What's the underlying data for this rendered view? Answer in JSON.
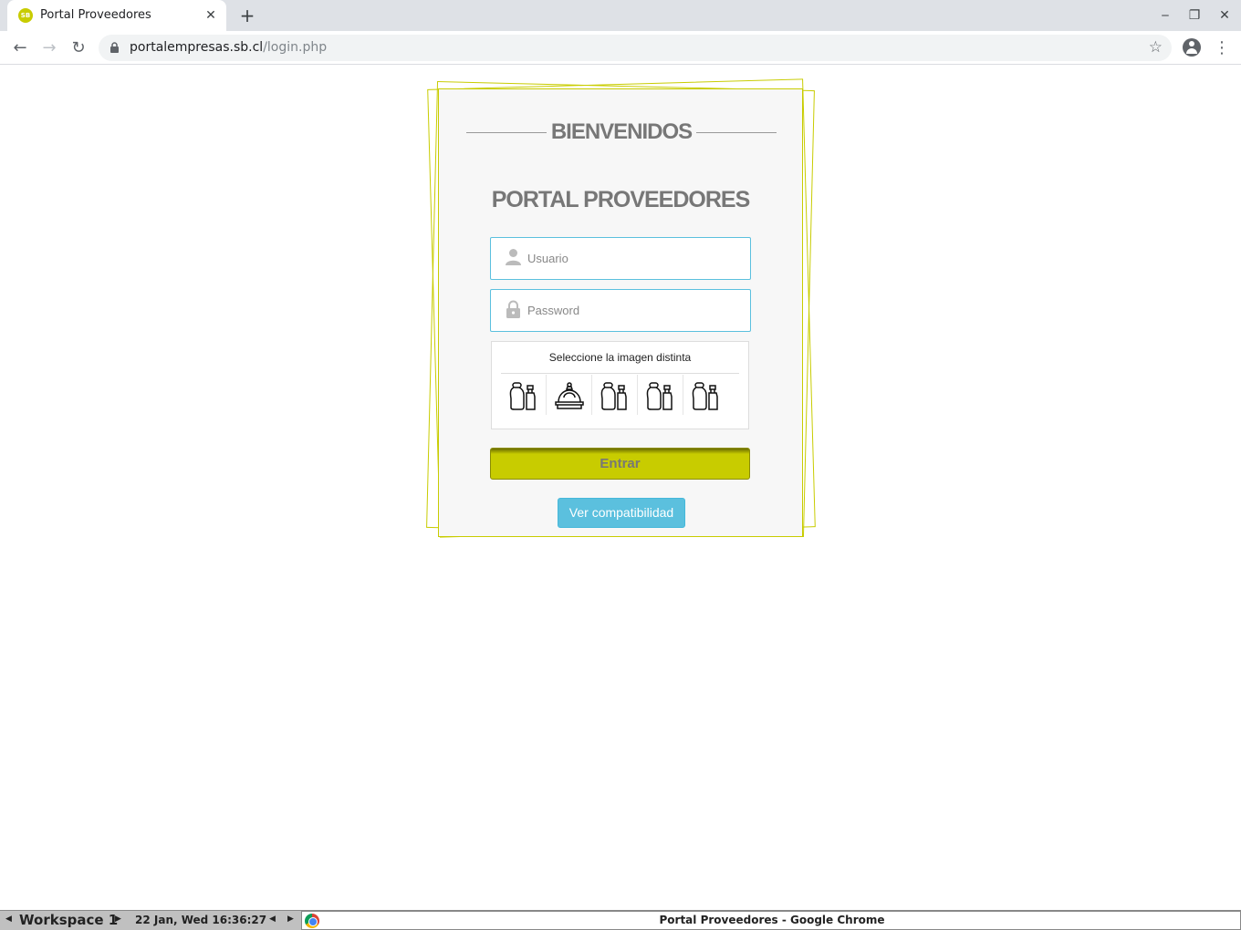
{
  "browser": {
    "tab": {
      "title": "Portal Proveedores",
      "favicon_text": "SB",
      "close_glyph": "✕"
    },
    "new_tab_glyph": "+",
    "window_controls": {
      "minimize": "‒",
      "restore": "❐",
      "close": "✕"
    },
    "nav": {
      "back": "←",
      "forward": "→",
      "reload": "↻"
    },
    "url": {
      "host": "portalempresas.sb.cl",
      "path": "/login.php"
    },
    "star_glyph": "☆",
    "menu_glyph": "⋮"
  },
  "login": {
    "welcome": "BIENVENIDOS",
    "title": "PORTAL PROVEEDORES",
    "username_placeholder": "Usuario",
    "password_placeholder": "Password",
    "captcha_prompt": "Seleccione la imagen distinta",
    "captcha_options": [
      "bottles-icon",
      "crown-pot-icon",
      "bottles-icon",
      "bottles-icon",
      "bottles-icon"
    ],
    "submit_label": "Entrar",
    "compat_label": "Ver compatibilidad"
  },
  "colors": {
    "accent": "#c8cc00",
    "info": "#5bc0de",
    "title_gray": "#777777"
  },
  "taskbar": {
    "left_arrow": "◀",
    "right_arrow": "▶",
    "workspace": "Workspace 1",
    "clock": "22 Jan, Wed 16:36:27",
    "window_title": "Portal Proveedores - Google Chrome"
  }
}
